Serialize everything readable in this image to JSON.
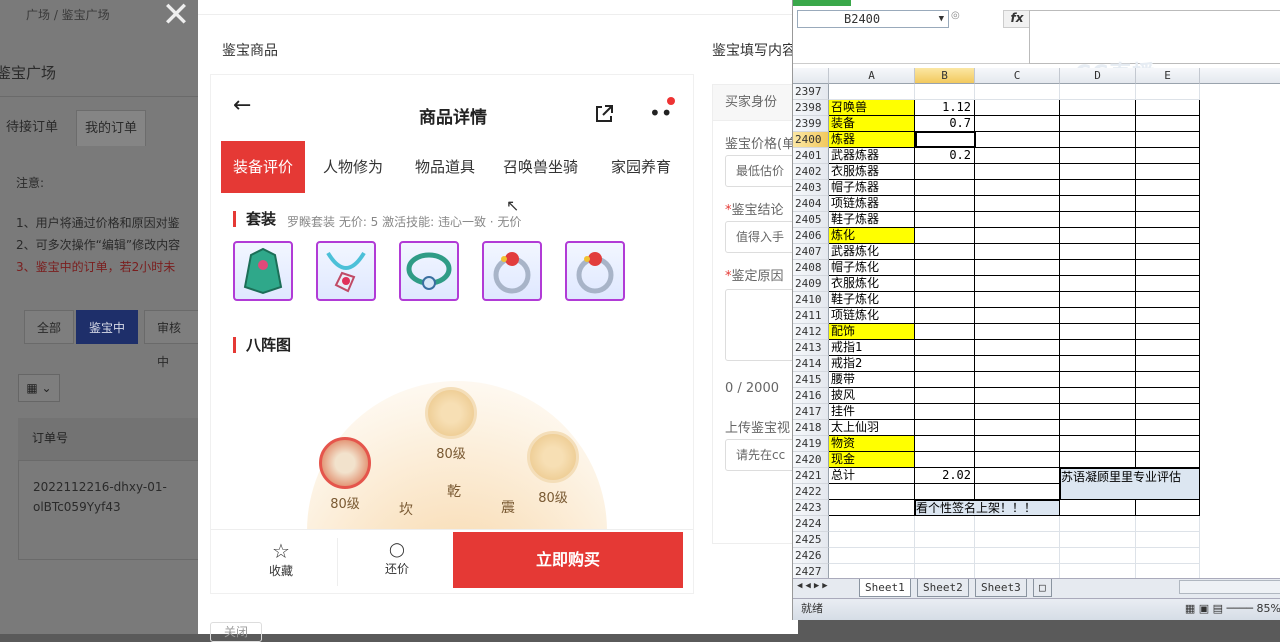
{
  "background_page": {
    "breadcrumb": "广场 / 鉴宝广场",
    "page_title": "鉴宝广场",
    "tabs": [
      "待接订单",
      "我的订单"
    ],
    "notice_label": "注意:",
    "notices": [
      "1、用户将通过价格和原因对鉴",
      "2、可多次操作“编辑”修改内容",
      "3、鉴宝中的订单，若2小时未"
    ],
    "filters": [
      "全部",
      "鉴宝中",
      "审核中"
    ],
    "grid_toggle": "▦ ⌄",
    "order_header": "订单号",
    "order_id_line1": "2022112216-dhxy-01-",
    "order_id_line2": "olBTc059Yyf43"
  },
  "modal": {
    "close_glyph": "✕",
    "left_title": "鉴宝商品",
    "right_title": "鉴宝填写内容",
    "phone": {
      "title": "商品详情",
      "tabs": [
        "装备评价",
        "人物修为",
        "物品道具",
        "召唤兽坐骑",
        "家园养育"
      ],
      "section_set": "套装",
      "set_info": "罗睺套装   无价: 5   激活技能: 违心一致 · 无价",
      "section_bagua": "八阵图",
      "levels": [
        "80级",
        "80级",
        "80级"
      ],
      "runes": [
        "坎",
        "乾",
        "震"
      ],
      "fav_label": "收藏",
      "counter_label": "还价",
      "buy_label": "立即购买"
    },
    "form": {
      "tab": "买家身份",
      "price_label": "鉴宝价格(单",
      "price_placeholder": "最低估价",
      "conclusion_label": "鉴宝结论",
      "conclusion_value": "值得入手",
      "reason_label": "鉴定原因",
      "counter": "0 / 2000",
      "upload_label": "上传鉴宝视",
      "upload_placeholder": "请先在cc"
    },
    "footer_btn": "关闭"
  },
  "excel": {
    "namebox": "B2400",
    "fx": "fx",
    "logo": "CC直播",
    "columns": [
      "A",
      "B",
      "C",
      "D",
      "E"
    ],
    "selected_column": "B",
    "selected_row": "2400",
    "rows": [
      {
        "n": "2397",
        "a": "",
        "b": "",
        "y": false
      },
      {
        "n": "2398",
        "a": "召唤兽",
        "b": "1.12",
        "y": true
      },
      {
        "n": "2399",
        "a": "装备",
        "b": "0.7",
        "y": true
      },
      {
        "n": "2400",
        "a": "炼器",
        "b": "",
        "y": true
      },
      {
        "n": "2401",
        "a": "武器炼器",
        "b": "0.2",
        "y": false
      },
      {
        "n": "2402",
        "a": "衣服炼器",
        "b": "",
        "y": false
      },
      {
        "n": "2403",
        "a": "帽子炼器",
        "b": "",
        "y": false
      },
      {
        "n": "2404",
        "a": "项链炼器",
        "b": "",
        "y": false
      },
      {
        "n": "2405",
        "a": "鞋子炼器",
        "b": "",
        "y": false
      },
      {
        "n": "2406",
        "a": "炼化",
        "b": "",
        "y": true
      },
      {
        "n": "2407",
        "a": "武器炼化",
        "b": "",
        "y": false
      },
      {
        "n": "2408",
        "a": "帽子炼化",
        "b": "",
        "y": false
      },
      {
        "n": "2409",
        "a": "衣服炼化",
        "b": "",
        "y": false
      },
      {
        "n": "2410",
        "a": "鞋子炼化",
        "b": "",
        "y": false
      },
      {
        "n": "2411",
        "a": "项链炼化",
        "b": "",
        "y": false
      },
      {
        "n": "2412",
        "a": "配饰",
        "b": "",
        "y": true
      },
      {
        "n": "2413",
        "a": "戒指1",
        "b": "",
        "y": false
      },
      {
        "n": "2414",
        "a": "戒指2",
        "b": "",
        "y": false
      },
      {
        "n": "2415",
        "a": "腰带",
        "b": "",
        "y": false
      },
      {
        "n": "2416",
        "a": "披风",
        "b": "",
        "y": false
      },
      {
        "n": "2417",
        "a": "挂件",
        "b": "",
        "y": false
      },
      {
        "n": "2418",
        "a": "太上仙羽",
        "b": "",
        "y": false
      },
      {
        "n": "2419",
        "a": "物资",
        "b": "",
        "y": true
      },
      {
        "n": "2420",
        "a": "现金",
        "b": "",
        "y": true
      },
      {
        "n": "2421",
        "a": "总计",
        "b": "2.02",
        "y": false
      },
      {
        "n": "2422",
        "a": "",
        "b": "",
        "y": false
      },
      {
        "n": "2423",
        "a": "",
        "b": "",
        "y": false
      },
      {
        "n": "2424",
        "a": "",
        "b": "",
        "y": false
      },
      {
        "n": "2425",
        "a": "",
        "b": "",
        "y": false
      },
      {
        "n": "2426",
        "a": "",
        "b": "",
        "y": false
      },
      {
        "n": "2427",
        "a": "",
        "b": "",
        "y": false
      }
    ],
    "d2421_text": "苏语凝顾里里专业评估",
    "b2423_text": "看个性签名上架！！！",
    "sheets": [
      "Sheet1",
      "Sheet2",
      "Sheet3"
    ],
    "status_left": "就绪",
    "zoom": "85%"
  },
  "colors": {
    "accent_red": "#e53935",
    "excel_yellow": "#ffff00",
    "excel_blue": "#dce6f1"
  }
}
